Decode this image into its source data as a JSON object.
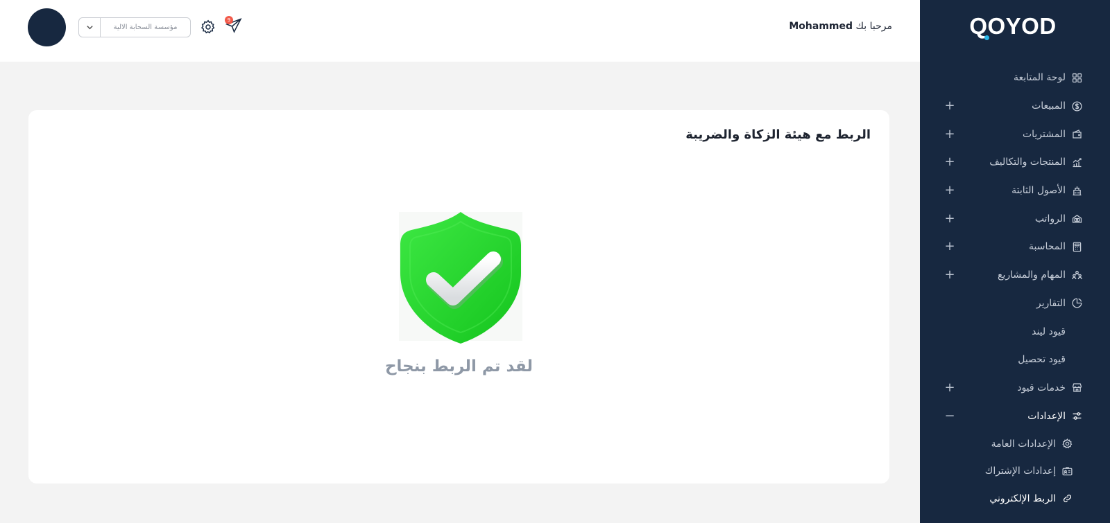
{
  "header": {
    "greeting_prefix": "مرحبا بك",
    "user_name": "Mohammed",
    "company_select_value": "مؤسسة السحابة الالية",
    "notification_count": "9"
  },
  "sidebar": {
    "logo_text": "QOYOD",
    "items": [
      {
        "label": "لوحة المتابعة",
        "icon": "dashboard-grid-icon",
        "expandable": false
      },
      {
        "label": "المبيعات",
        "icon": "dollar-coin-icon",
        "expandable": true
      },
      {
        "label": "المشتريات",
        "icon": "wallet-icon",
        "expandable": true
      },
      {
        "label": "المنتجات والتكاليف",
        "icon": "growth-chart-icon",
        "expandable": true
      },
      {
        "label": "الأصول الثابتة",
        "icon": "building-icon",
        "expandable": true
      },
      {
        "label": "الرواتب",
        "icon": "money-hand-icon",
        "expandable": true
      },
      {
        "label": "المحاسبة",
        "icon": "calculator-icon",
        "expandable": true
      },
      {
        "label": "المهام والمشاريع",
        "icon": "team-icon",
        "expandable": true
      },
      {
        "label": "التقارير",
        "icon": "pie-chart-icon",
        "expandable": false
      },
      {
        "label": "قيود ليند",
        "icon": "",
        "expandable": false
      },
      {
        "label": "قيود تحصيل",
        "icon": "",
        "expandable": false
      },
      {
        "label": "خدمات قيود",
        "icon": "store-icon",
        "expandable": true
      },
      {
        "label": "الإعدادات",
        "icon": "sliders-icon",
        "expandable": true,
        "expanded": true
      }
    ],
    "settings_subitems": [
      {
        "label": "الإعدادات العامة",
        "icon": "gear-icon"
      },
      {
        "label": "إعدادات الإشتراك",
        "icon": "id-card-icon"
      },
      {
        "label": "الربط الإلكتروني",
        "icon": "link-icon",
        "current": true
      }
    ],
    "plus_symbol": "+",
    "minus_symbol": "−"
  },
  "main": {
    "card_title": "الربط مع هيئة الزكاة والضريبة",
    "success_message": "لقد تم الربط بنجاح"
  },
  "colors": {
    "sidebar_bg": "#172840",
    "shield_green": "#22d52a",
    "success_text": "#8e98a6"
  }
}
